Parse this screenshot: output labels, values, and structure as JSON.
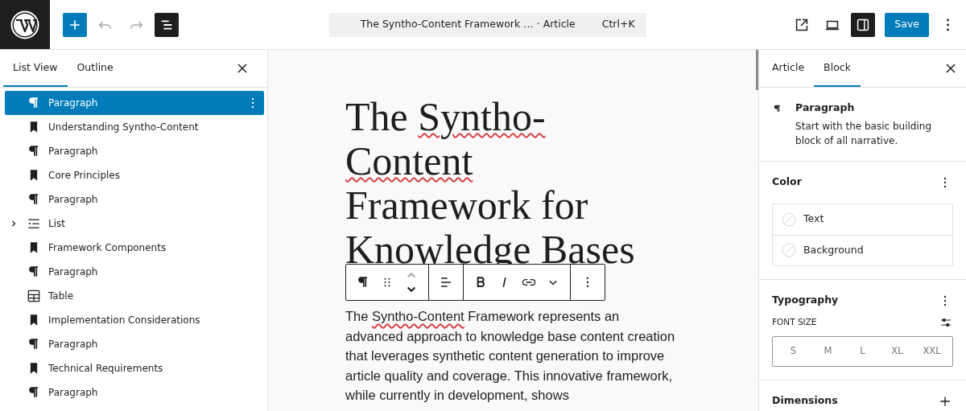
{
  "top_bar": {
    "document_title": "The Syntho-Content Framework …",
    "document_type": "· Article",
    "shortcut": "Ctrl+K",
    "undo": {
      "disabled": true
    },
    "redo": {
      "disabled": true
    },
    "list_view_toggle": {
      "pressed": true
    },
    "settings_toggle": {
      "pressed": true
    },
    "save": "Save"
  },
  "left_panel": {
    "tabs": [
      {
        "label": "List View",
        "selected": true
      },
      {
        "label": "Outline",
        "selected": false
      }
    ],
    "items": [
      {
        "kind": "paragraph",
        "label": "Paragraph",
        "selected": true
      },
      {
        "kind": "heading",
        "label": "Understanding Syntho-Content",
        "selected": false
      },
      {
        "kind": "paragraph",
        "label": "Paragraph",
        "selected": false
      },
      {
        "kind": "heading",
        "label": "Core Principles",
        "selected": false
      },
      {
        "kind": "paragraph",
        "label": "Paragraph",
        "selected": false
      },
      {
        "kind": "list",
        "label": "List",
        "selected": false,
        "expanded": false
      },
      {
        "kind": "heading",
        "label": "Framework Components",
        "selected": false
      },
      {
        "kind": "paragraph",
        "label": "Paragraph",
        "selected": false
      },
      {
        "kind": "table",
        "label": "Table",
        "selected": false
      },
      {
        "kind": "heading",
        "label": "Implementation Considerations",
        "selected": false
      },
      {
        "kind": "paragraph",
        "label": "Paragraph",
        "selected": false
      },
      {
        "kind": "heading",
        "label": "Technical Requirements",
        "selected": false
      },
      {
        "kind": "paragraph",
        "label": "Paragraph",
        "selected": false
      }
    ]
  },
  "editor": {
    "title": [
      {
        "text": "The ",
        "misspelled": false
      },
      {
        "text": "Syntho-Content",
        "misspelled": true
      },
      {
        "text": " Framework for Knowledge Bases",
        "misspelled": false
      }
    ],
    "paragraph": [
      {
        "text": "The ",
        "misspelled": false
      },
      {
        "text": "Syntho-Content",
        "misspelled": true
      },
      {
        "text": " Framework represents an advanced approach to knowledge base content creation that leverages synthetic content generation to improve article quality and coverage. This innovative framework, while currently in development, shows",
        "misspelled": false
      }
    ]
  },
  "right_panel": {
    "tabs": [
      {
        "label": "Article",
        "selected": false
      },
      {
        "label": "Block",
        "selected": true
      }
    ],
    "block": {
      "name": "Paragraph",
      "description": "Start with the basic building block of all narrative."
    },
    "color": {
      "title": "Color",
      "items": [
        "Text",
        "Background"
      ]
    },
    "typography": {
      "title": "Typography",
      "font_size_label": "FONT SIZE",
      "sizes": [
        {
          "label": "S",
          "selected": false
        },
        {
          "label": "M",
          "selected": false
        },
        {
          "label": "L",
          "selected": false
        },
        {
          "label": "XL",
          "selected": false
        },
        {
          "label": "XXL",
          "selected": false
        }
      ]
    },
    "dimensions": {
      "title": "Dimensions"
    }
  }
}
